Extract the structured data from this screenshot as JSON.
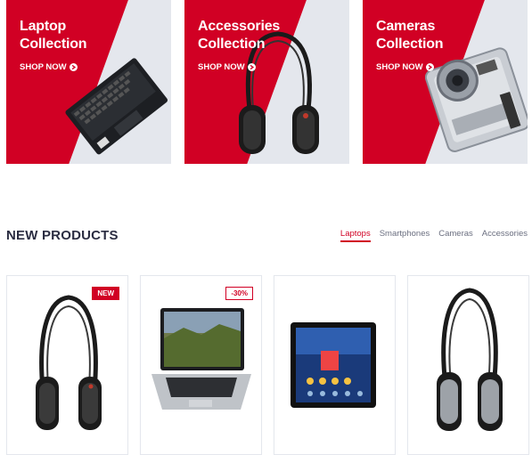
{
  "collections": [
    {
      "line1": "Laptop",
      "line2": "Collection",
      "cta": "SHOP NOW",
      "icon": "arrow-circle-right-icon"
    },
    {
      "line1": "Accessories",
      "line2": "Collection",
      "cta": "SHOP NOW",
      "icon": "arrow-circle-right-icon"
    },
    {
      "line1": "Cameras",
      "line2": "Collection",
      "cta": "SHOP NOW",
      "icon": "arrow-circle-right-icon"
    }
  ],
  "section": {
    "title": "NEW PRODUCTS",
    "tabs": [
      "Laptops",
      "Smartphones",
      "Cameras",
      "Accessories"
    ],
    "active_tab": "Laptops"
  },
  "products": [
    {
      "label": "NEW",
      "image": "headphones"
    },
    {
      "label": "-30%",
      "image": "laptop"
    },
    {
      "image": "tablet"
    },
    {
      "image": "headphones"
    }
  ],
  "colors": {
    "accent": "#d10024",
    "banner_bg": "#e4e7ed",
    "heading": "#2b2d42"
  }
}
